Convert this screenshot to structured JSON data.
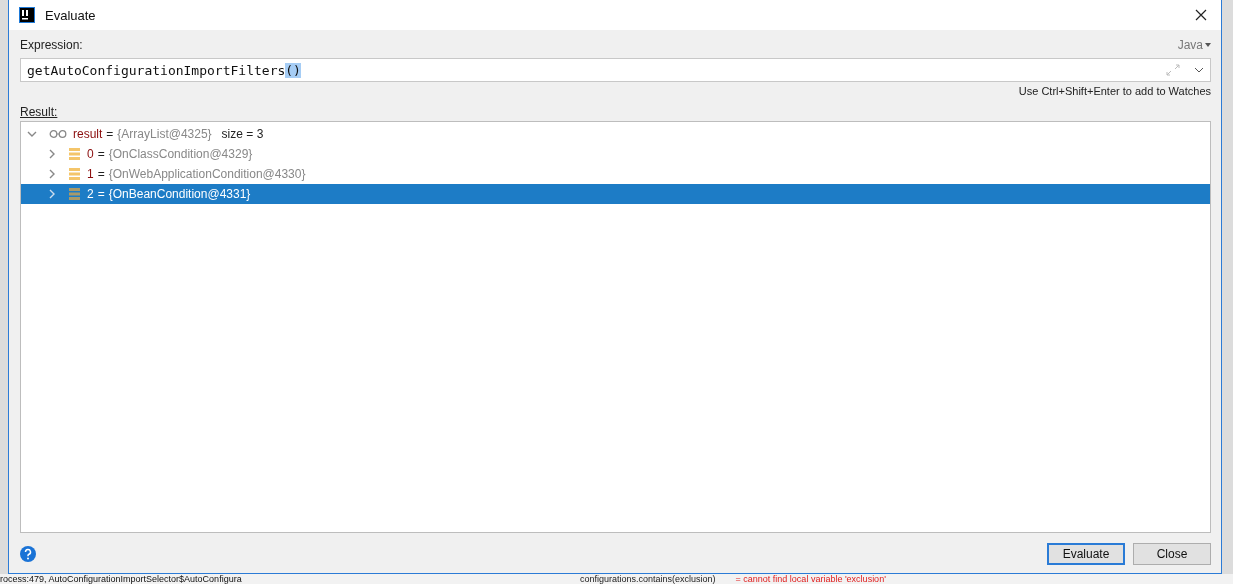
{
  "window": {
    "title": "Evaluate"
  },
  "expression": {
    "label": "Expression:",
    "language": "Java",
    "value": "getAutoConfigurationImportFilters",
    "highlighted_part": "()"
  },
  "hint": "Use Ctrl+Shift+Enter to add to Watches",
  "result": {
    "label": "Result:",
    "tree": [
      {
        "kind": "object",
        "name": "result",
        "separator": "=",
        "value": "{ArrayList@4325}",
        "extra": "size = 3",
        "expanded": true,
        "selected": false,
        "children": [
          {
            "kind": "element",
            "name": "0",
            "separator": "=",
            "value": "{OnClassCondition@4329}",
            "expanded": false,
            "selected": false
          },
          {
            "kind": "element",
            "name": "1",
            "separator": "=",
            "value": "{OnWebApplicationCondition@4330}",
            "expanded": false,
            "selected": false
          },
          {
            "kind": "element",
            "name": "2",
            "separator": "=",
            "value": "{OnBeanCondition@4331}",
            "expanded": false,
            "selected": true
          }
        ]
      }
    ]
  },
  "buttons": [
    {
      "label": "Evaluate",
      "default": true
    },
    {
      "label": "Close",
      "default": false
    }
  ],
  "background": {
    "frame_text": "rocess:479, AutoConfigurationImportSelector$AutoConfigura",
    "error_expression": "configurations.contains(exclusion)",
    "error_message": "= cannot find local variable 'exclusion'"
  }
}
